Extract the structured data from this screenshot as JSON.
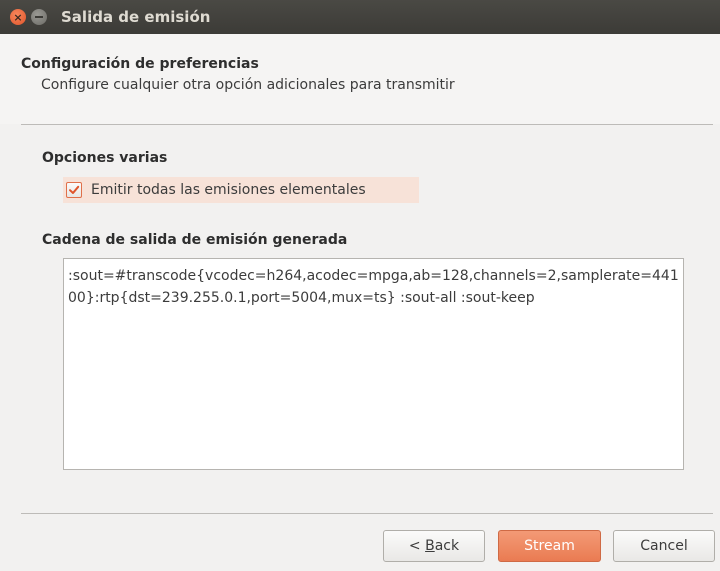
{
  "window": {
    "title": "Salida de emisión"
  },
  "header": {
    "title": "Configuración de preferencias",
    "subtitle": "Configure cualquier otra opción adicionales para transmitir"
  },
  "misc_options": {
    "label": "Opciones varias",
    "checkbox": {
      "label": "Emitir todas las emisiones elementales",
      "checked": true
    }
  },
  "output": {
    "label": "Cadena de salida de emisión generada",
    "value": ":sout=#transcode{vcodec=h264,acodec=mpga,ab=128,channels=2,samplerate=44100}:rtp{dst=239.255.0.1,port=5004,mux=ts} :sout-all :sout-keep"
  },
  "buttons": {
    "back_prefix": "< ",
    "back_mnemonic": "B",
    "back_suffix": "ack",
    "stream": "Stream",
    "cancel": "Cancel"
  },
  "colors": {
    "titlebar": "#3c3b37",
    "accent": "#e95420",
    "checkbox_highlight": "#f7e2d8"
  },
  "icons": {
    "close": "close-icon",
    "minimize": "minimize-icon",
    "checkmark": "checkmark-icon"
  }
}
